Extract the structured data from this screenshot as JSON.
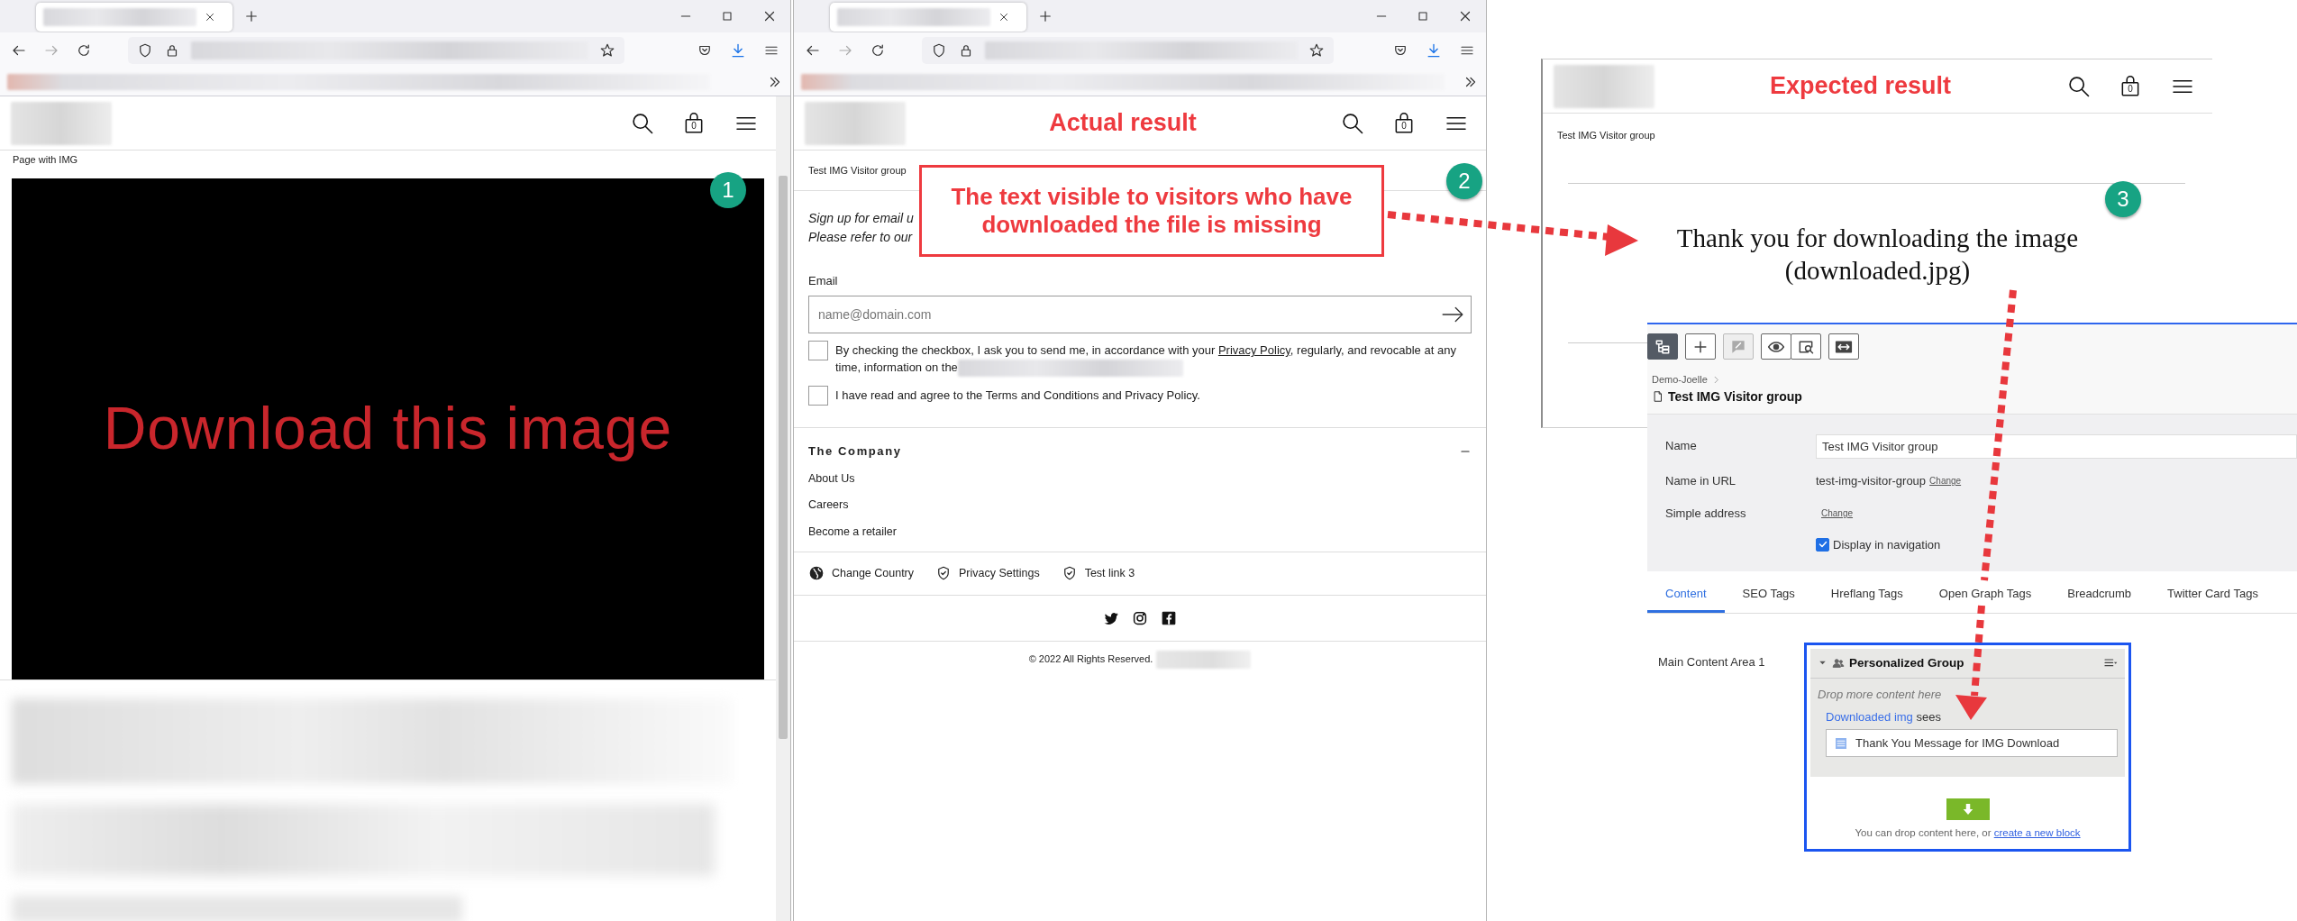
{
  "left_browser": {
    "page_label": "Page with IMG",
    "cart_count": "0",
    "image_text": "Download this image",
    "badge": "1"
  },
  "actual_browser": {
    "heading": "Actual result",
    "cart_count": "0",
    "breadcrumb": "Test IMG Visitor group",
    "intro_lines": [
      "Sign up for email u",
      "Please refer to our"
    ],
    "callout": "The text visible to visitors who have downloaded the file is missing",
    "badge": "2",
    "email": {
      "label": "Email",
      "placeholder": "name@domain.com"
    },
    "consents": [
      {
        "text": "By checking the checkbox, I ask you to send me, in accordance with your ",
        "link": "Privacy Policy",
        "after": ", regularly, and revocable at any time, information on the",
        "checked": false
      },
      {
        "text": "I have read and agree to the Terms and Conditions and Privacy Policy.",
        "checked": false
      }
    ],
    "footer_section": {
      "title": "The Company",
      "expanded": true,
      "links": [
        "About Us",
        "Careers",
        "Become a retailer"
      ]
    },
    "footer_links": [
      {
        "label": "Change Country",
        "kind": "globe"
      },
      {
        "label": "Privacy Settings",
        "kind": "shield"
      },
      {
        "label": "Test link 3",
        "kind": "shield"
      }
    ],
    "copyright": "© 2022 All Rights Reserved."
  },
  "expected_page": {
    "heading": "Expected result",
    "cart_count": "0",
    "breadcrumb": "Test IMG Visitor group",
    "message_lines": [
      "Thank you for downloading the image",
      "(downloaded.jpg)"
    ],
    "badge": "3"
  },
  "cms": {
    "toolbar": [
      {
        "kind": "tree",
        "active": true,
        "disabled": false
      },
      {
        "kind": "add",
        "active": false,
        "disabled": false
      },
      {
        "kind": "comment",
        "active": false,
        "disabled": true
      },
      {
        "kind": "view",
        "active": false,
        "disabled": false
      },
      {
        "kind": "preview",
        "active": false,
        "disabled": false
      },
      {
        "kind": "compare",
        "active": false,
        "disabled": false
      }
    ],
    "breadcrumb": "Demo-Joelle",
    "title": "Test IMG Visitor group",
    "fields": [
      {
        "label": "Name",
        "kind": "input",
        "value": "Test IMG Visitor group"
      },
      {
        "label": "Name in URL",
        "kind": "text",
        "value": "test-img-visitor-group",
        "link": "Change"
      },
      {
        "label": "Simple address",
        "kind": "link",
        "link": "Change"
      }
    ],
    "display_in_navigation": {
      "label": "Display in navigation",
      "checked": true
    },
    "tabs": [
      {
        "label": "Content",
        "selected": true
      },
      {
        "label": "SEO Tags",
        "selected": false
      },
      {
        "label": "Hreflang Tags",
        "selected": false
      },
      {
        "label": "Open Graph Tags",
        "selected": false
      },
      {
        "label": "Breadcrumb",
        "selected": false
      },
      {
        "label": "Twitter Card Tags",
        "selected": false
      }
    ],
    "content_area": {
      "label": "Main Content Area 1",
      "group": {
        "title": "Personalized Group",
        "expanded": true,
        "drop_hint": "Drop more content here",
        "audience": "Downloaded img",
        "audience_suffix": "sees",
        "blocks": [
          "Thank You Message for IMG Download"
        ]
      },
      "footer_text": "You can drop content here, or",
      "footer_link": "create a new block"
    }
  }
}
